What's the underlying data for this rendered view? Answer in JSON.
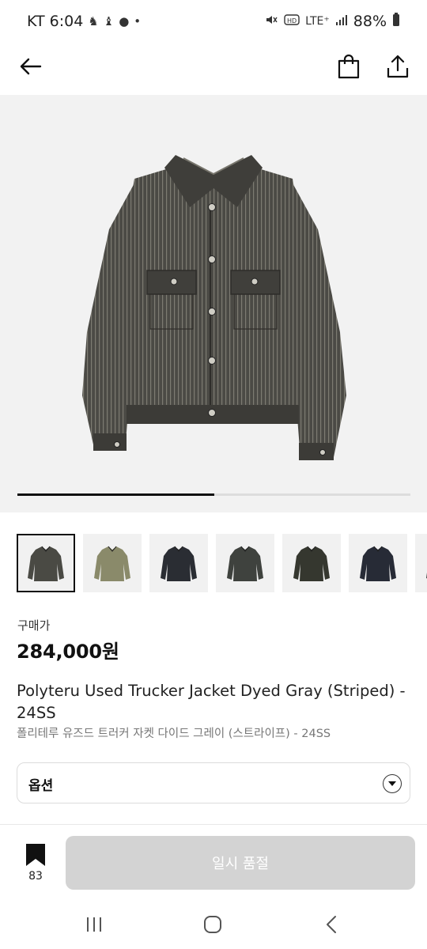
{
  "status_bar": {
    "carrier_time": "KT 6:04",
    "notification_icons": [
      "app-icon",
      "app-icon",
      "chat-icon",
      "dot"
    ],
    "network": "LTE⁺",
    "battery": "88%",
    "icons": [
      "mute-icon",
      "hd-icon",
      "signal-icon",
      "battery-icon"
    ]
  },
  "app_bar": {
    "back_icon": "arrow-left-icon",
    "cart_icon": "shopping-bag-icon",
    "share_icon": "share-icon"
  },
  "gallery": {
    "image_description_icon": "trucker-jacket-image",
    "progress_fraction": 0.5,
    "thumbnails": [
      {
        "name": "dyed-gray-striped",
        "color": "#4a4a44",
        "selected": true
      },
      {
        "name": "camo",
        "color": "#8a8a6a",
        "selected": false
      },
      {
        "name": "black",
        "color": "#2a2d33",
        "selected": false
      },
      {
        "name": "dark-gray",
        "color": "#3f423e",
        "selected": false
      },
      {
        "name": "charcoal",
        "color": "#35372f",
        "selected": false
      },
      {
        "name": "indigo-black",
        "color": "#272b36",
        "selected": false
      },
      {
        "name": "partial",
        "color": "#3a3a3a",
        "selected": false
      }
    ]
  },
  "product": {
    "price_label": "구매가",
    "price": "284,000원",
    "title_en": "Polyteru Used Trucker Jacket Dyed Gray (Striped) - 24SS",
    "title_ko": "폴리테루 유즈드 트러커 자켓 다이드 그레이 (스트라이프) - 24SS"
  },
  "options": {
    "label": "옵션"
  },
  "action_bar": {
    "bookmark_count": "83",
    "button_label": "일시 품절"
  },
  "colors": {
    "button_disabled": "#d3d3d3",
    "progress": "#111111"
  }
}
